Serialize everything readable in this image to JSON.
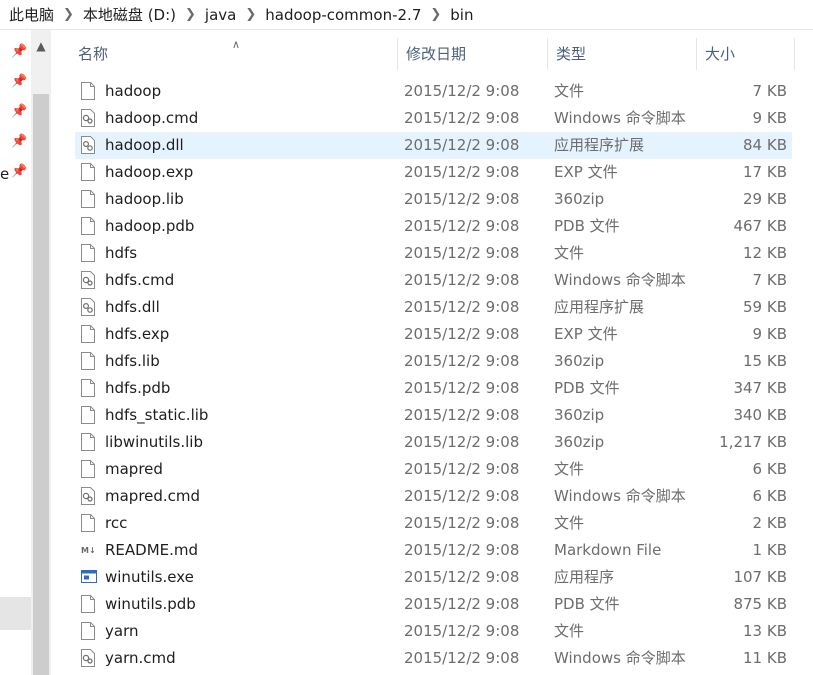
{
  "breadcrumb": [
    "此电脑",
    "本地磁盘 (D:)",
    "java",
    "hadoop-common-2.7",
    "bin"
  ],
  "nav_pane": {
    "cut_label": "e"
  },
  "columns": {
    "name": "名称",
    "date": "修改日期",
    "type": "类型",
    "size": "大小"
  },
  "files": [
    {
      "name": "hadoop",
      "date": "2015/12/2 9:08",
      "type": "文件",
      "size": "7 KB",
      "icon": "blank-file-icon"
    },
    {
      "name": "hadoop.cmd",
      "date": "2015/12/2 9:08",
      "type": "Windows 命令脚本",
      "size": "9 KB",
      "icon": "script-file-icon"
    },
    {
      "name": "hadoop.dll",
      "date": "2015/12/2 9:08",
      "type": "应用程序扩展",
      "size": "84 KB",
      "icon": "dll-file-icon",
      "selected": true
    },
    {
      "name": "hadoop.exp",
      "date": "2015/12/2 9:08",
      "type": "EXP 文件",
      "size": "17 KB",
      "icon": "blank-file-icon"
    },
    {
      "name": "hadoop.lib",
      "date": "2015/12/2 9:08",
      "type": "360zip",
      "size": "29 KB",
      "icon": "blank-file-icon"
    },
    {
      "name": "hadoop.pdb",
      "date": "2015/12/2 9:08",
      "type": "PDB 文件",
      "size": "467 KB",
      "icon": "blank-file-icon"
    },
    {
      "name": "hdfs",
      "date": "2015/12/2 9:08",
      "type": "文件",
      "size": "12 KB",
      "icon": "blank-file-icon"
    },
    {
      "name": "hdfs.cmd",
      "date": "2015/12/2 9:08",
      "type": "Windows 命令脚本",
      "size": "7 KB",
      "icon": "script-file-icon"
    },
    {
      "name": "hdfs.dll",
      "date": "2015/12/2 9:08",
      "type": "应用程序扩展",
      "size": "59 KB",
      "icon": "dll-file-icon"
    },
    {
      "name": "hdfs.exp",
      "date": "2015/12/2 9:08",
      "type": "EXP 文件",
      "size": "9 KB",
      "icon": "blank-file-icon"
    },
    {
      "name": "hdfs.lib",
      "date": "2015/12/2 9:08",
      "type": "360zip",
      "size": "15 KB",
      "icon": "blank-file-icon"
    },
    {
      "name": "hdfs.pdb",
      "date": "2015/12/2 9:08",
      "type": "PDB 文件",
      "size": "347 KB",
      "icon": "blank-file-icon"
    },
    {
      "name": "hdfs_static.lib",
      "date": "2015/12/2 9:08",
      "type": "360zip",
      "size": "340 KB",
      "icon": "blank-file-icon"
    },
    {
      "name": "libwinutils.lib",
      "date": "2015/12/2 9:08",
      "type": "360zip",
      "size": "1,217 KB",
      "icon": "blank-file-icon"
    },
    {
      "name": "mapred",
      "date": "2015/12/2 9:08",
      "type": "文件",
      "size": "6 KB",
      "icon": "blank-file-icon"
    },
    {
      "name": "mapred.cmd",
      "date": "2015/12/2 9:08",
      "type": "Windows 命令脚本",
      "size": "6 KB",
      "icon": "script-file-icon"
    },
    {
      "name": "rcc",
      "date": "2015/12/2 9:08",
      "type": "文件",
      "size": "2 KB",
      "icon": "blank-file-icon"
    },
    {
      "name": "README.md",
      "date": "2015/12/2 9:08",
      "type": "Markdown File",
      "size": "1 KB",
      "icon": "markdown-file-icon"
    },
    {
      "name": "winutils.exe",
      "date": "2015/12/2 9:08",
      "type": "应用程序",
      "size": "107 KB",
      "icon": "exe-file-icon"
    },
    {
      "name": "winutils.pdb",
      "date": "2015/12/2 9:08",
      "type": "PDB 文件",
      "size": "875 KB",
      "icon": "blank-file-icon"
    },
    {
      "name": "yarn",
      "date": "2015/12/2 9:08",
      "type": "文件",
      "size": "13 KB",
      "icon": "blank-file-icon"
    },
    {
      "name": "yarn.cmd",
      "date": "2015/12/2 9:08",
      "type": "Windows 命令脚本",
      "size": "11 KB",
      "icon": "script-file-icon"
    }
  ]
}
